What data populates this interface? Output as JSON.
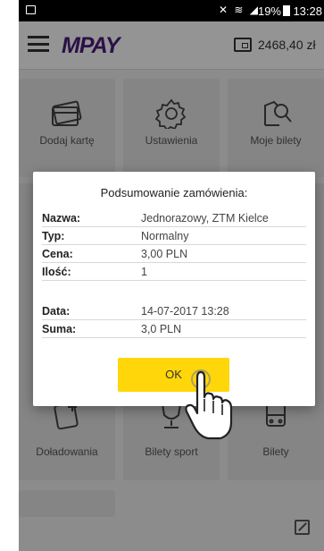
{
  "status_bar": {
    "battery_percent": "19%",
    "time": "13:28",
    "icons": "✕ ≋ ◢"
  },
  "app_bar": {
    "logo": "MPAY",
    "balance": "2468,40 zł"
  },
  "tiles": [
    {
      "label": "Dodaj kartę",
      "icon": "card-icon"
    },
    {
      "label": "Ustawienia",
      "icon": "gear-icon"
    },
    {
      "label": "Moje bilety",
      "icon": "ticket-search-icon"
    },
    {
      "label": "Doładowania",
      "icon": "topup-icon"
    },
    {
      "label": "Bilety sport",
      "icon": "trophy-icon"
    },
    {
      "label": "Bilety",
      "icon": "bus-icon"
    }
  ],
  "dialog": {
    "title": "Podsumowanie zamówienia:",
    "rows": [
      {
        "key": "Nazwa:",
        "value": "Jednorazowy, ZTM Kielce"
      },
      {
        "key": "Typ:",
        "value": "Normalny"
      },
      {
        "key": "Cena:",
        "value": "3,00 PLN"
      },
      {
        "key": "Ilość:",
        "value": "1"
      },
      {
        "key": "Data:",
        "value": "14-07-2017 13:28"
      },
      {
        "key": "Suma:",
        "value": "3,0 PLN"
      }
    ],
    "ok_label": "OK"
  },
  "colors": {
    "accent": "#ffd60a",
    "logo": "#4a1c7d"
  }
}
